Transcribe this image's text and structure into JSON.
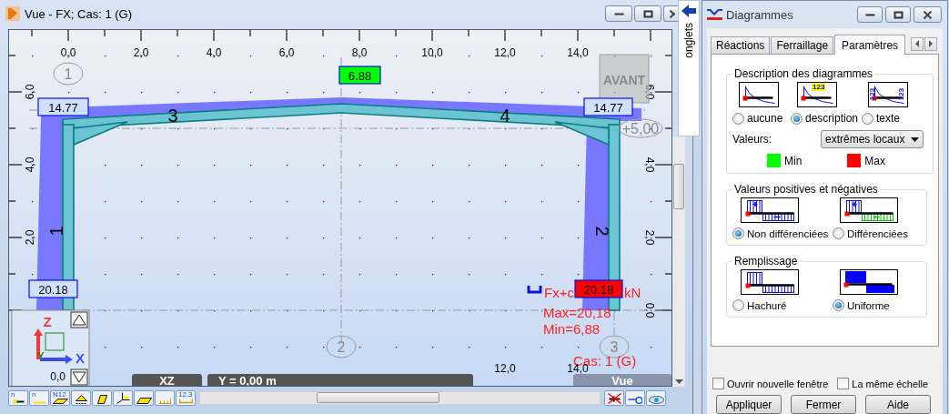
{
  "view_window": {
    "title": "Vue - FX; Cas: 1 (G)",
    "top_ruler": [
      "0,0",
      "2,0",
      "4,0",
      "6,0",
      "8,0",
      "10,0",
      "12,0",
      "14,0"
    ],
    "left_ruler": [
      "6,0",
      "4,0",
      "2,0"
    ],
    "right_ruler": [
      "6,0",
      "4,0",
      "2,0",
      "0,0"
    ],
    "bottom_ruler": [
      "0,0",
      "12,0",
      "14,0"
    ],
    "axis_markers": [
      {
        "label": "1",
        "kind": "top"
      },
      {
        "label": "2",
        "kind": "bottom"
      },
      {
        "label": "3",
        "kind": "bottom"
      }
    ],
    "level_markers": [
      "+5,00"
    ],
    "member_numbers": [
      "1",
      "2",
      "3",
      "4"
    ],
    "values": [
      {
        "text": "14.77",
        "kind": "plain"
      },
      {
        "text": "6.88",
        "kind": "min"
      },
      {
        "text": "14.77",
        "kind": "plain"
      },
      {
        "text": "20.18",
        "kind": "plain"
      },
      {
        "text": "20.18",
        "kind": "max"
      }
    ],
    "legend": {
      "quantity": "Fx+c",
      "unit": "kN",
      "max": "Max=20,18",
      "min": "Min=6,88"
    },
    "case_label": "Cas: 1 (G)",
    "view_cube": "AVANT",
    "axes": [
      "Z",
      "X",
      "Y"
    ],
    "plane_bar": "XZ",
    "coordinate_bar": "Y = 0,00 m",
    "view_bar": "Vue",
    "toolbar": [
      {
        "kind": "node-line",
        "text": "n"
      },
      {
        "kind": "node",
        "text": "n"
      },
      {
        "kind": "numbered",
        "text": "N12"
      },
      {
        "kind": "support"
      },
      {
        "kind": "member"
      },
      {
        "kind": "axes"
      },
      {
        "kind": "plate"
      },
      {
        "kind": "load"
      },
      {
        "kind": "dimension",
        "text": "12.3"
      }
    ],
    "right_tools": [
      {
        "kind": "crossed"
      },
      {
        "kind": "key"
      },
      {
        "kind": "eye"
      }
    ]
  },
  "side_tab": {
    "label": "onglets"
  },
  "dialog": {
    "title": "Diagrammes",
    "tabs": [
      {
        "label": "Réactions",
        "selected": false
      },
      {
        "label": "Ferraillage",
        "selected": false
      },
      {
        "label": "Paramètres",
        "selected": true
      }
    ],
    "groups": [
      {
        "title": "Description des diagrammes",
        "options": [
          {
            "label": "aucune",
            "kind": "curve",
            "selected": false
          },
          {
            "label": "description",
            "kind": "curve-badge",
            "badges": [
              "123"
            ],
            "selected": true
          },
          {
            "label": "texte",
            "kind": "curve-side",
            "badges": [
              "123",
              "123"
            ],
            "selected": false
          }
        ]
      },
      {
        "title": "Valeurs positives et négatives",
        "options": [
          {
            "label": "Non différenciées",
            "kind": "signs",
            "selected": true
          },
          {
            "label": "Différenciées",
            "kind": "signs-green",
            "selected": false
          }
        ]
      },
      {
        "title": "Remplissage",
        "options": [
          {
            "label": "Hachuré",
            "kind": "hatch",
            "selected": false
          },
          {
            "label": "Uniforme",
            "kind": "solid",
            "selected": true
          }
        ]
      }
    ],
    "values_label": "Valeurs:",
    "values_dropdown": "extrêmes locaux",
    "swatches": [
      {
        "label": "Min",
        "color": "#00ff00"
      },
      {
        "label": "Max",
        "color": "#ff0000"
      }
    ],
    "checkboxes": [
      {
        "label": "Ouvrir nouvelle fenêtre",
        "checked": false
      },
      {
        "label": "La même échelle",
        "checked": false
      }
    ],
    "buttons": [
      "Appliquer",
      "Fermer",
      "Aide"
    ]
  }
}
